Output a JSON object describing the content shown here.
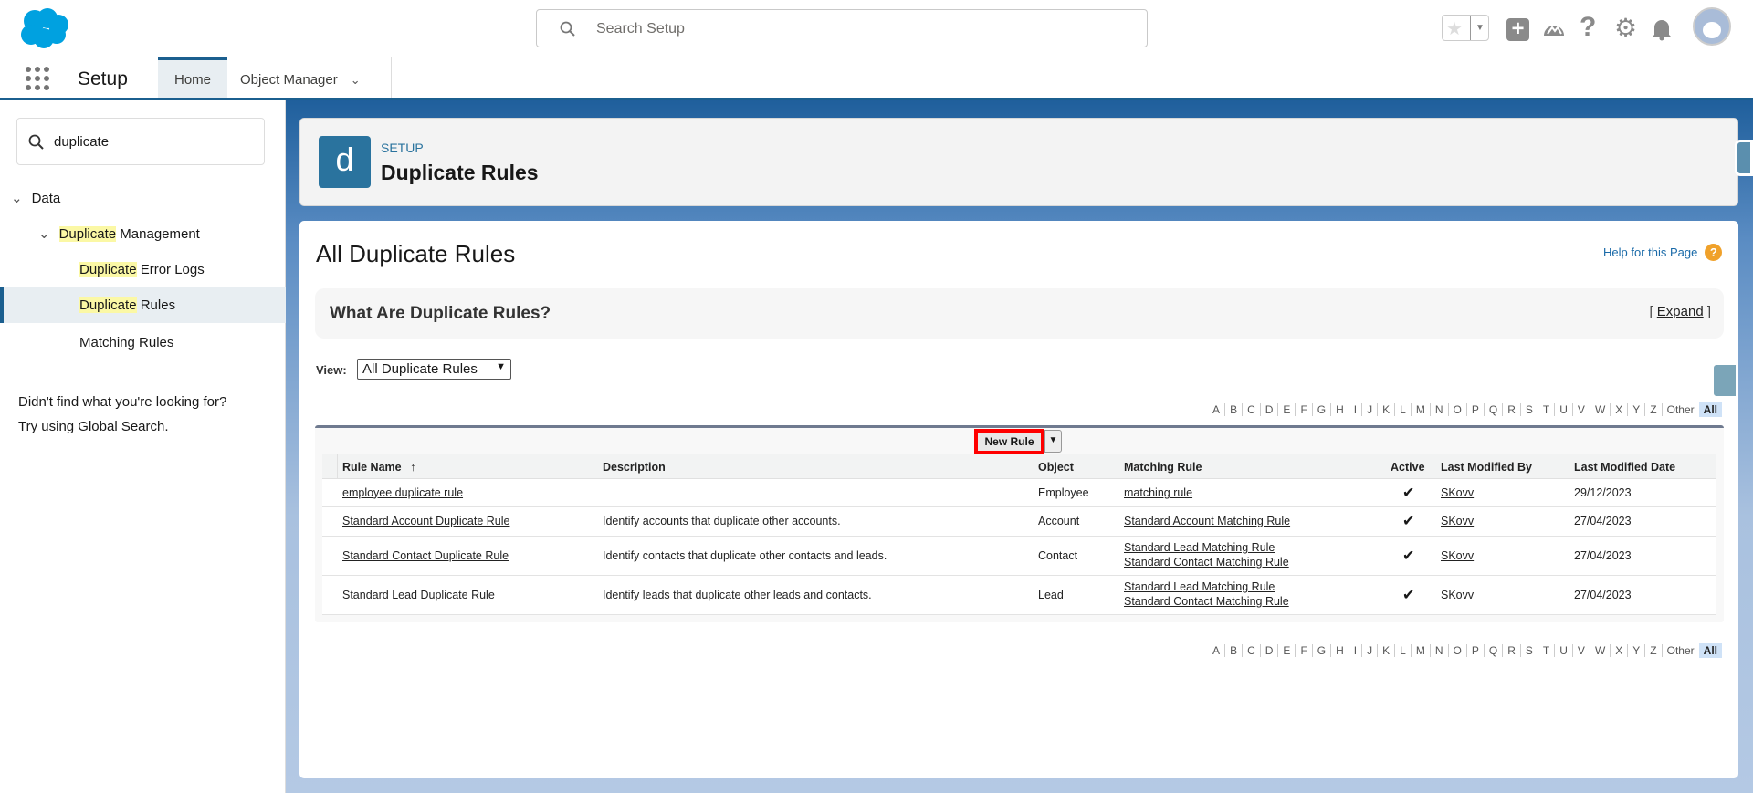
{
  "header": {
    "search_placeholder": "Search Setup"
  },
  "nav": {
    "app": "Setup",
    "tabs": [
      {
        "label": "Home"
      },
      {
        "label": "Object Manager"
      }
    ]
  },
  "sidebar": {
    "search_value": "duplicate",
    "tree": {
      "data": "Data",
      "group_hl": "Duplicate",
      "group_rest": " Management",
      "items": [
        {
          "hl": "Duplicate",
          "rest": " Error Logs"
        },
        {
          "hl": "Duplicate",
          "rest": " Rules"
        },
        {
          "hl": "",
          "rest": "Matching Rules"
        }
      ]
    },
    "help_line1": "Didn't find what you're looking for?",
    "help_line2": "Try using Global Search."
  },
  "page_header": {
    "icon_letter": "d",
    "eyebrow": "SETUP",
    "title": "Duplicate Rules"
  },
  "content": {
    "title": "All Duplicate Rules",
    "help_link": "Help for this Page",
    "what_are": "What Are Duplicate Rules?",
    "expand": "Expand",
    "view_label": "View:",
    "view_value": "All Duplicate Rules",
    "new_rule": "New Rule",
    "alphabet": [
      "A",
      "B",
      "C",
      "D",
      "E",
      "F",
      "G",
      "H",
      "I",
      "J",
      "K",
      "L",
      "M",
      "N",
      "O",
      "P",
      "Q",
      "R",
      "S",
      "T",
      "U",
      "V",
      "W",
      "X",
      "Y",
      "Z",
      "Other",
      "All"
    ],
    "columns": {
      "rule_name": "Rule Name",
      "sort": "↑",
      "description": "Description",
      "object": "Object",
      "matching_rule": "Matching Rule",
      "active": "Active",
      "modified_by": "Last Modified By",
      "modified_date": "Last Modified Date"
    },
    "rows": [
      {
        "name": "employee duplicate rule",
        "desc": "",
        "object": "Employee",
        "match1": "matching rule",
        "match2": "",
        "active": true,
        "by": "SKovv",
        "date": "29/12/2023"
      },
      {
        "name": "Standard Account Duplicate Rule",
        "desc": "Identify accounts that duplicate other accounts.",
        "object": "Account",
        "match1": "Standard Account Matching Rule",
        "match2": "",
        "active": true,
        "by": "SKovv",
        "date": "27/04/2023"
      },
      {
        "name": "Standard Contact Duplicate Rule",
        "desc": "Identify contacts that duplicate other contacts and leads.",
        "object": "Contact",
        "match1": "Standard Lead Matching Rule",
        "match2": "Standard Contact Matching Rule",
        "active": true,
        "by": "SKovv",
        "date": "27/04/2023"
      },
      {
        "name": "Standard Lead Duplicate Rule",
        "desc": "Identify leads that duplicate other leads and contacts.",
        "object": "Lead",
        "match1": "Standard Lead Matching Rule",
        "match2": "Standard Contact Matching Rule",
        "active": true,
        "by": "SKovv",
        "date": "27/04/2023"
      }
    ]
  },
  "colors": {
    "brand": "#00a1e0",
    "accent": "#1b5f8f",
    "highlight": "#fbf8a5",
    "new_rule_outline": "#ff0000"
  }
}
